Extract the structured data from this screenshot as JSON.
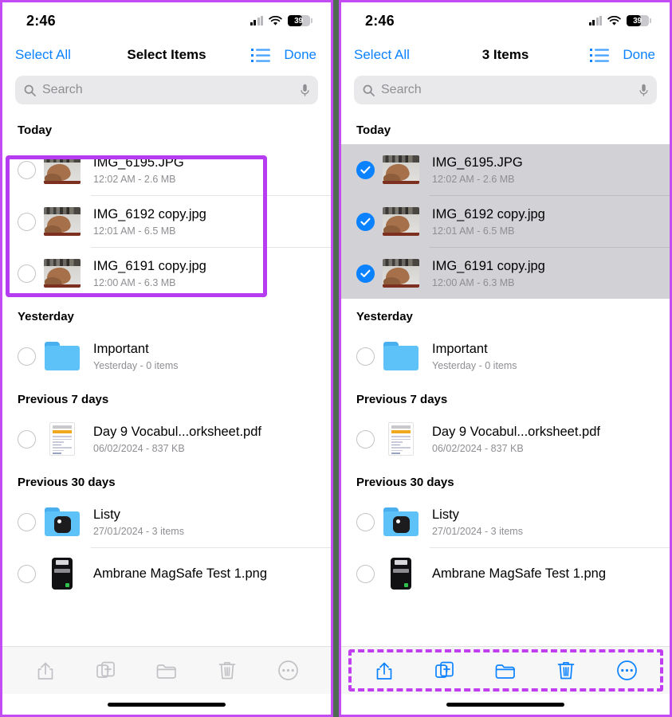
{
  "meta": {
    "app": "Files",
    "panel_count": 2,
    "accent_blue": "#0b82ff",
    "annotation_purple": "#b53cf0",
    "selection_gray": "#d1d1d6"
  },
  "status_bar": {
    "time": "2:46",
    "battery_percent": "39",
    "cellular_icon": "cellular-bars-icon",
    "wifi_icon": "wifi-icon",
    "battery_icon": "battery-icon"
  },
  "left_panel": {
    "nav": {
      "select_all": "Select All",
      "title": "Select Items",
      "list_view_icon": "list-view-icon",
      "done": "Done"
    },
    "search": {
      "placeholder": "Search",
      "search_icon": "search-icon",
      "mic_icon": "microphone-icon"
    },
    "selected_count": 0,
    "toolbar_enabled": false
  },
  "right_panel": {
    "nav": {
      "select_all": "Select All",
      "title": "3 Items",
      "list_view_icon": "list-view-icon",
      "done": "Done"
    },
    "search": {
      "placeholder": "Search",
      "search_icon": "search-icon",
      "mic_icon": "microphone-icon"
    },
    "selected_count": 3,
    "toolbar_enabled": true
  },
  "sections": [
    {
      "header": "Today",
      "selected_group": true,
      "items": [
        {
          "name": "IMG_6195.JPG",
          "sub": "12:02 AM - 2.6 MB",
          "thumb": "photo",
          "checked_right": true
        },
        {
          "name": "IMG_6192 copy.jpg",
          "sub": "12:01 AM - 6.5 MB",
          "thumb": "photo",
          "checked_right": true
        },
        {
          "name": "IMG_6191 copy.jpg",
          "sub": "12:00 AM - 6.3 MB",
          "thumb": "photo",
          "checked_right": true
        }
      ]
    },
    {
      "header": "Yesterday",
      "selected_group": false,
      "items": [
        {
          "name": "Important",
          "sub": "Yesterday - 0 items",
          "thumb": "folder-plain",
          "checked_right": false
        }
      ]
    },
    {
      "header": "Previous 7 days",
      "selected_group": false,
      "items": [
        {
          "name": "Day 9 Vocabul...orksheet.pdf",
          "sub": "06/02/2024 - 837 KB",
          "thumb": "pdf",
          "checked_right": false
        }
      ]
    },
    {
      "header": "Previous 30 days",
      "selected_group": false,
      "items": [
        {
          "name": "Listy",
          "sub": "27/01/2024 - 3 items",
          "thumb": "folder-badge",
          "checked_right": false
        },
        {
          "name": "Ambrane MagSafe Test 1.png",
          "sub": "",
          "thumb": "screenshot",
          "checked_right": false
        }
      ]
    }
  ],
  "toolbar": {
    "items": [
      {
        "icon": "share-icon",
        "label": "Share"
      },
      {
        "icon": "duplicate-icon",
        "label": "Duplicate"
      },
      {
        "icon": "folder-icon",
        "label": "Move to Folder"
      },
      {
        "icon": "trash-icon",
        "label": "Delete"
      },
      {
        "icon": "more-icon",
        "label": "More"
      }
    ]
  },
  "annotations": [
    {
      "type": "solid",
      "target": "today-group-left",
      "panel": "left"
    },
    {
      "type": "dashed",
      "target": "toolbar-right",
      "panel": "right"
    }
  ]
}
